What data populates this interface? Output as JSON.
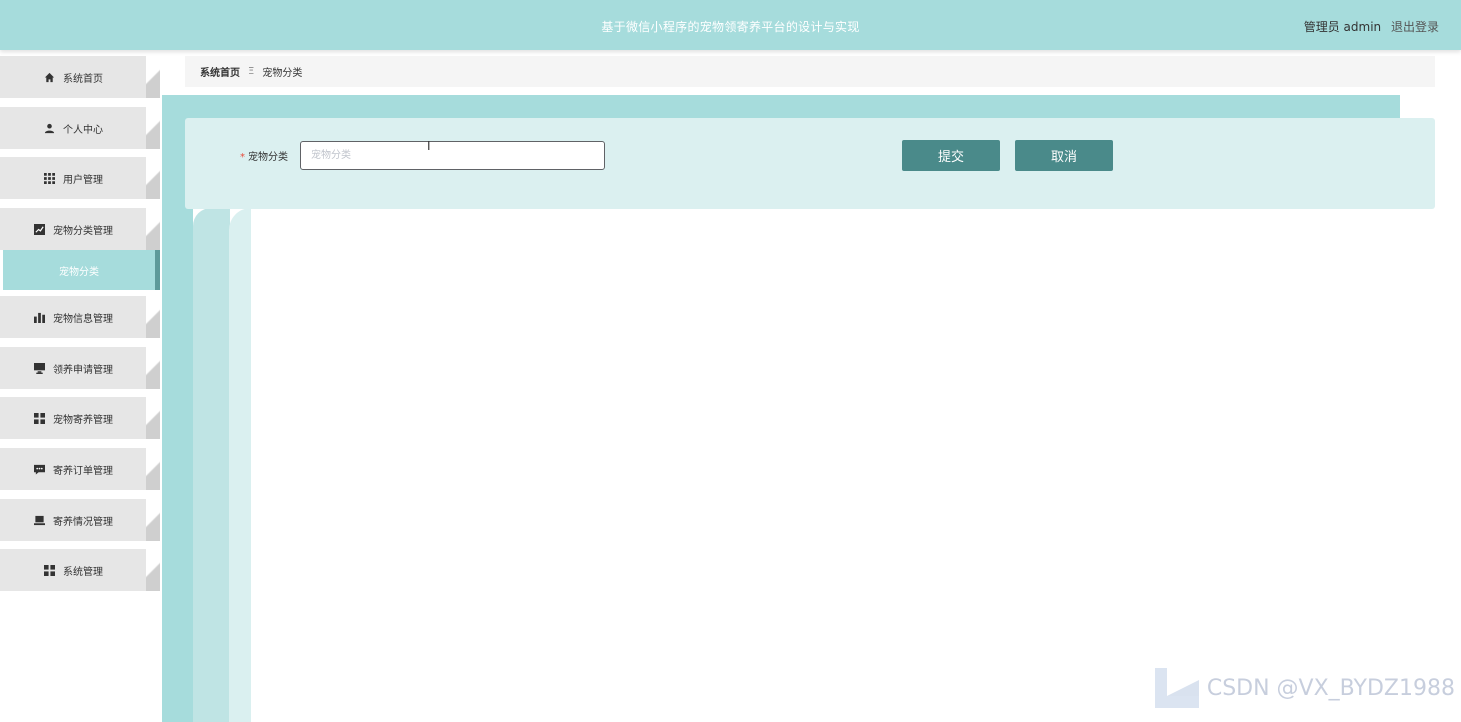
{
  "header": {
    "title": "基于微信小程序的宠物领寄养平台的设计与实现",
    "user_label": "管理员 admin",
    "logout_label": "退出登录"
  },
  "sidebar": {
    "items": [
      {
        "label": "系统首页",
        "icon": "home-icon"
      },
      {
        "label": "个人中心",
        "icon": "user-icon"
      },
      {
        "label": "用户管理",
        "icon": "grid-icon"
      },
      {
        "label": "宠物分类管理",
        "icon": "chart-icon"
      },
      {
        "label": "宠物信息管理",
        "icon": "bar-chart-icon"
      },
      {
        "label": "领养申请管理",
        "icon": "monitor-icon"
      },
      {
        "label": "宠物寄养管理",
        "icon": "apps-icon"
      },
      {
        "label": "寄养订单管理",
        "icon": "message-icon"
      },
      {
        "label": "寄养情况管理",
        "icon": "laptop-icon"
      },
      {
        "label": "系统管理",
        "icon": "apps-icon"
      }
    ],
    "active_sub": "宠物分类"
  },
  "breadcrumb": {
    "home": "系统首页",
    "separator": "Ξ",
    "current": "宠物分类"
  },
  "form": {
    "field_label": "宠物分类",
    "required_mark": "*",
    "field_value": "",
    "field_placeholder": "宠物分类",
    "submit_label": "提交",
    "cancel_label": "取消"
  },
  "watermark": {
    "text": "CSDN @VX_BYDZ1988"
  },
  "colors": {
    "accent": "#a6dcdc",
    "button": "#4a8a8a",
    "active_border": "#5e9a9a"
  }
}
